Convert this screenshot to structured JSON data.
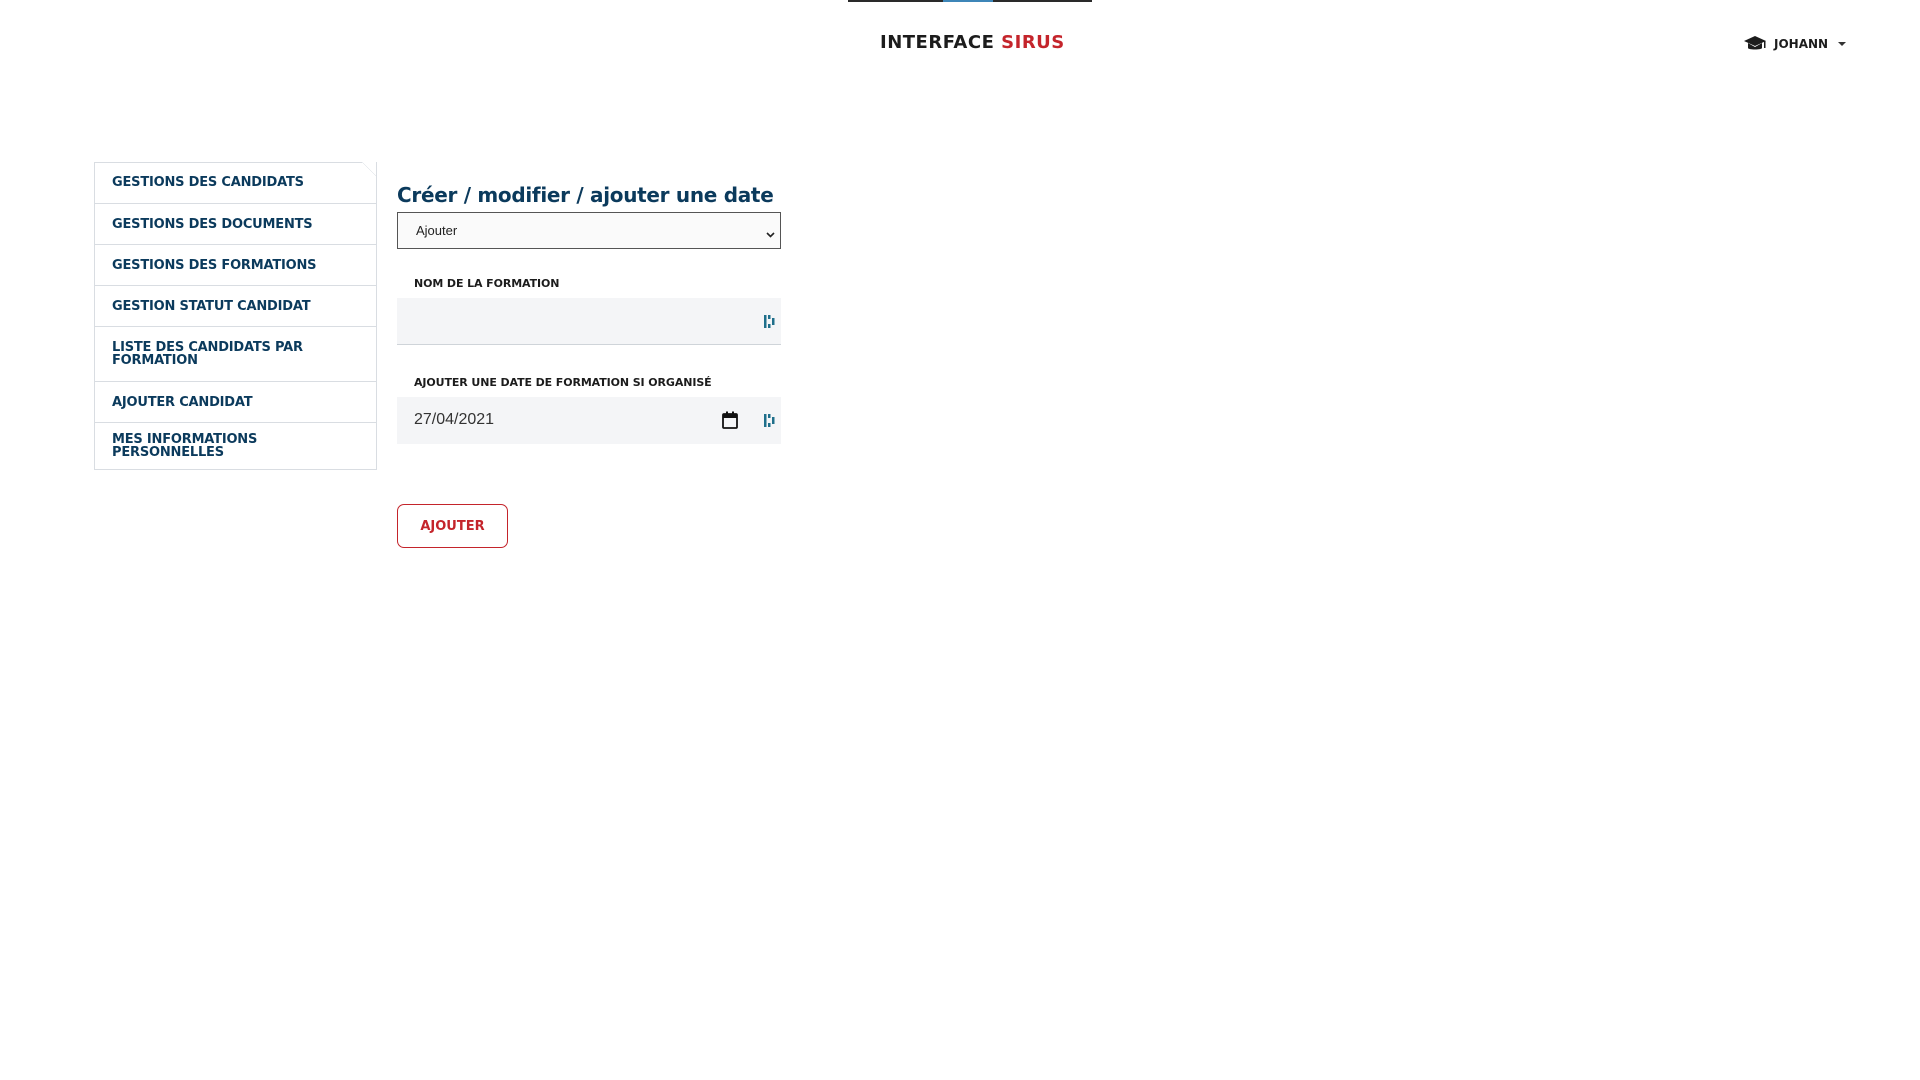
{
  "header": {
    "brand_part1": "INTERFACE",
    "brand_part2": "SIRUS",
    "user_name": "JOHANN",
    "colors": {
      "brand_red": "#c4242b",
      "navy": "#0b3a5c"
    }
  },
  "sidebar": {
    "items": [
      {
        "label": "GESTIONS DES CANDIDATS"
      },
      {
        "label": "GESTIONS DES DOCUMENTS"
      },
      {
        "label": "GESTIONS DES FORMATIONS"
      },
      {
        "label": "GESTION STATUT CANDIDAT"
      },
      {
        "label": "LISTE DES CANDIDATS PAR FORMATION"
      },
      {
        "label": "AJOUTER CANDIDAT"
      },
      {
        "label": "MES INFORMATIONS PERSONNELLES"
      }
    ]
  },
  "main": {
    "title": "Créer / modifier / ajouter une date",
    "mode_select": {
      "value": "Ajouter"
    },
    "formation_name": {
      "label": "NOM DE LA FORMATION",
      "value": ""
    },
    "formation_date": {
      "label": "AJOUTER UNE DATE DE FORMATION SI ORGANISÉ",
      "value": "27/04/2021"
    },
    "submit_label": "AJOUTER"
  }
}
